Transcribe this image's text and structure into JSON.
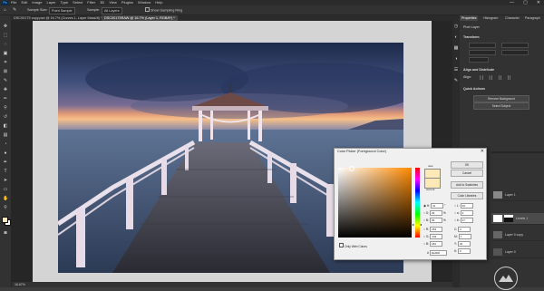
{
  "app": {
    "logo": "Ps"
  },
  "menus": [
    "File",
    "Edit",
    "Image",
    "Layer",
    "Type",
    "Select",
    "Filter",
    "3D",
    "View",
    "Plugins",
    "Window",
    "Help"
  ],
  "window_controls": [
    "—",
    "▢",
    "✕"
  ],
  "options": {
    "sample_size_label": "Sample Size:",
    "sample_size_value": "Point Sample",
    "sample_label": "Sample:",
    "sample_value": "All Layers",
    "show_ring_label": "Show Sampling Ring"
  },
  "tabs": [
    {
      "label": "DSC00175 copy.psd @ 16.7% (Curves 1, Layer Mask/8) *"
    },
    {
      "label": "DSC00175RAW @ 16.7% (Layer 1, RGB/8*) *"
    }
  ],
  "status": {
    "zoom": "16.67%"
  },
  "panels": {
    "tabs": [
      "Properties",
      "Histogram",
      "Character",
      "Paragraph"
    ],
    "pixel_layer": "Pixel Layer",
    "transform_title": "Transform",
    "align_title": "Align and Distribute",
    "align_sub": "Align:",
    "quick_actions_title": "Quick Actions",
    "remove_bg": "Remove Background",
    "select_subject": "Select Subject",
    "layer_names": [
      "Layer 1",
      "Levels 1",
      "Layer 0 copy",
      "Layer 0"
    ]
  },
  "picker": {
    "title": "Color Picker (Foreground Color)",
    "close": "✕",
    "ok": "OK",
    "cancel": "Cancel",
    "add_swatches": "Add to Swatches",
    "color_libraries": "Color Libraries",
    "new_label": "new",
    "current_label": "current",
    "web_colors": "Only Web Colors",
    "new_color": "#fde9b8",
    "current_color": "#fde9b8",
    "fields": {
      "H": "41",
      "S": "29",
      "B": "99",
      "R": "253",
      "G": "233",
      "B2": "184",
      "L": "93",
      "a": "2",
      "b": "27",
      "C": "2",
      "M": "7",
      "Y": "32",
      "K": "0",
      "hex": "fde9b8"
    },
    "units": {
      "deg": "°",
      "pct": "%"
    }
  }
}
